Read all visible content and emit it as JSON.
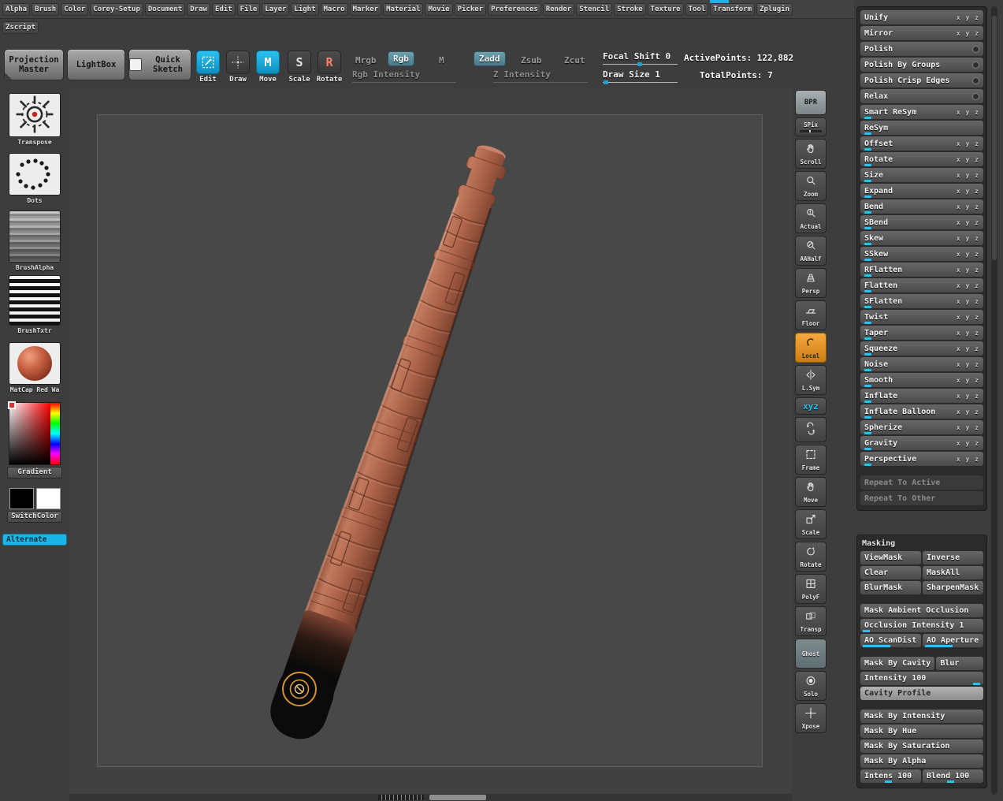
{
  "colors": {
    "cyan": "#1ab4e6",
    "orange": "#f0a030",
    "model_brown": "#ab6148"
  },
  "menubar": {
    "row1": [
      "Alpha",
      "Brush",
      "Color",
      "Corey-Setup",
      "Document",
      "Draw",
      "Edit",
      "File",
      "Layer",
      "Light",
      "Macro",
      "Marker",
      "Material",
      "Movie",
      "Picker",
      "Preferences",
      "Render",
      "Stencil",
      "Stroke",
      "Texture",
      "Tool",
      "Transform",
      "Zplugin"
    ],
    "row2": [
      "Zscript"
    ]
  },
  "toolbar": {
    "projection_master": "Projection Master",
    "lightbox": "LightBox",
    "quick_sketch": "Quick Sketch",
    "edit": "Edit",
    "draw": "Draw",
    "move": "Move",
    "scale": "Scale",
    "rotate": "Rotate",
    "move_key": "M",
    "scale_key": "S",
    "rotate_key": "R",
    "mrgb": "Mrgb",
    "rgb": "Rgb",
    "m": "M",
    "rgb_intensity": "Rgb Intensity",
    "zadd": "Zadd",
    "zsub": "Zsub",
    "zcut": "Zcut",
    "z_intensity": "Z Intensity",
    "focal_shift": "Focal Shift 0",
    "draw_size": "Draw Size 1",
    "active_points": "ActivePoints: 122,882",
    "total_points": "TotalPoints: 7"
  },
  "sidebar": {
    "transpose": "Transpose",
    "dots": "Dots",
    "brush_alpha": "BrushAlpha",
    "brush_txtr": "BrushTxtr",
    "matcap": "MatCap Red Wa",
    "gradient": "Gradient",
    "switch_color": "SwitchColor",
    "alternate": "Alternate"
  },
  "right_shelf": [
    {
      "label": "BPR",
      "icon": "none",
      "state": "light"
    },
    {
      "label": "SPix",
      "icon": "none",
      "state": "spix"
    },
    {
      "label": "Scroll",
      "icon": "hand-icon"
    },
    {
      "label": "Zoom",
      "icon": "zoom-icon"
    },
    {
      "label": "Actual",
      "icon": "actual-icon"
    },
    {
      "label": "AAHalf",
      "icon": "aahalf-icon"
    },
    {
      "label": "Persp",
      "icon": "persp-icon"
    },
    {
      "label": "Floor",
      "icon": "floor-icon"
    },
    {
      "label": "Local",
      "icon": "local-icon",
      "state": "orange"
    },
    {
      "label": "L.Sym",
      "icon": "lsym-icon"
    },
    {
      "label": "xyz",
      "icon": "none",
      "state": "cyan-text"
    },
    {
      "label": "",
      "icon": "spin-icon",
      "state": "plain"
    },
    {
      "label": "Frame",
      "icon": "frame-icon"
    },
    {
      "label": "Move",
      "icon": "hand-icon"
    },
    {
      "label": "Scale",
      "icon": "scale-icon"
    },
    {
      "label": "Rotate",
      "icon": "rotate-icon"
    },
    {
      "label": "PolyF",
      "icon": "polyf-icon"
    },
    {
      "label": "Transp",
      "icon": "transp-icon"
    },
    {
      "label": "Ghost",
      "icon": "none",
      "state": "active"
    },
    {
      "label": "Solo",
      "icon": "solo-icon"
    },
    {
      "label": "Xpose",
      "icon": "xpose-icon"
    }
  ],
  "deformation": {
    "axes_letters": "x y z",
    "items": [
      {
        "label": "Unify",
        "axes": true
      },
      {
        "label": "Mirror",
        "axes": true
      },
      {
        "label": "Polish",
        "toggle": true
      },
      {
        "label": "Polish By Groups",
        "toggle": true
      },
      {
        "label": "Polish Crisp Edges",
        "toggle": true
      },
      {
        "label": "Relax",
        "toggle": true
      },
      {
        "label": "Smart ReSym",
        "axes": true,
        "tick": true
      },
      {
        "label": "ReSym",
        "tick": true
      },
      {
        "label": "Offset",
        "axes": true,
        "tick": true
      },
      {
        "label": "Rotate",
        "axes": true,
        "tick": true
      },
      {
        "label": "Size",
        "axes": true,
        "tick": true
      },
      {
        "label": "Expand",
        "axes": true,
        "tick": true
      },
      {
        "label": "Bend",
        "axes": true,
        "tick": true
      },
      {
        "label": "SBend",
        "axes": true,
        "tick": true
      },
      {
        "label": "Skew",
        "axes": true,
        "tick": true
      },
      {
        "label": "SSkew",
        "axes": true,
        "tick": true
      },
      {
        "label": "RFlatten",
        "axes": true,
        "tick": true
      },
      {
        "label": "Flatten",
        "axes": true,
        "tick": true
      },
      {
        "label": "SFlatten",
        "axes": true,
        "tick": true
      },
      {
        "label": "Twist",
        "axes": true,
        "tick": true
      },
      {
        "label": "Taper",
        "axes": true,
        "tick": true
      },
      {
        "label": "Squeeze",
        "axes": true,
        "tick": true
      },
      {
        "label": "Noise",
        "axes": true,
        "tick": true
      },
      {
        "label": "Smooth",
        "axes": true,
        "tick": true
      },
      {
        "label": "Inflate",
        "axes": true,
        "tick": true
      },
      {
        "label": "Inflate Balloon",
        "axes": true,
        "tick": true
      },
      {
        "label": "Spherize",
        "axes": true,
        "tick": true
      },
      {
        "label": "Gravity",
        "axes": true,
        "tick": true
      },
      {
        "label": "Perspective",
        "axes": true,
        "tick": true
      },
      {
        "gap": true
      },
      {
        "label": "Repeat To Active",
        "disabled": true
      },
      {
        "label": "Repeat To Other",
        "disabled": true
      }
    ]
  },
  "masking": {
    "title": "Masking",
    "rows": [
      {
        "type": "pair",
        "buttons": [
          "ViewMask",
          "Inverse"
        ]
      },
      {
        "type": "pair",
        "buttons": [
          "Clear",
          "MaskAll"
        ]
      },
      {
        "type": "pair",
        "buttons": [
          "BlurMask",
          "SharpenMask"
        ]
      },
      {
        "type": "gap"
      },
      {
        "type": "wide",
        "label": "Mask Ambient Occlusion"
      },
      {
        "type": "wide",
        "label": "Occlusion Intensity 1",
        "tick": "left"
      },
      {
        "type": "pair",
        "buttons": [
          "AO ScanDist",
          "AO Aperture"
        ],
        "tick": "left-both"
      },
      {
        "type": "gap"
      },
      {
        "type": "pair2",
        "buttons": [
          "Mask By Cavity",
          "Blur"
        ]
      },
      {
        "type": "wide",
        "label": "Intensity 100",
        "tick": "right"
      },
      {
        "type": "wide",
        "label": "Cavity Profile",
        "light": true
      },
      {
        "type": "gap"
      },
      {
        "type": "wide",
        "label": "Mask By Intensity"
      },
      {
        "type": "wide",
        "label": "Mask By Hue"
      },
      {
        "type": "wide",
        "label": "Mask By Saturation"
      },
      {
        "type": "wide",
        "label": "Mask By Alpha"
      },
      {
        "type": "pair",
        "buttons": [
          "Intens 100",
          "Blend 100"
        ],
        "tick": "mid-both"
      }
    ]
  }
}
